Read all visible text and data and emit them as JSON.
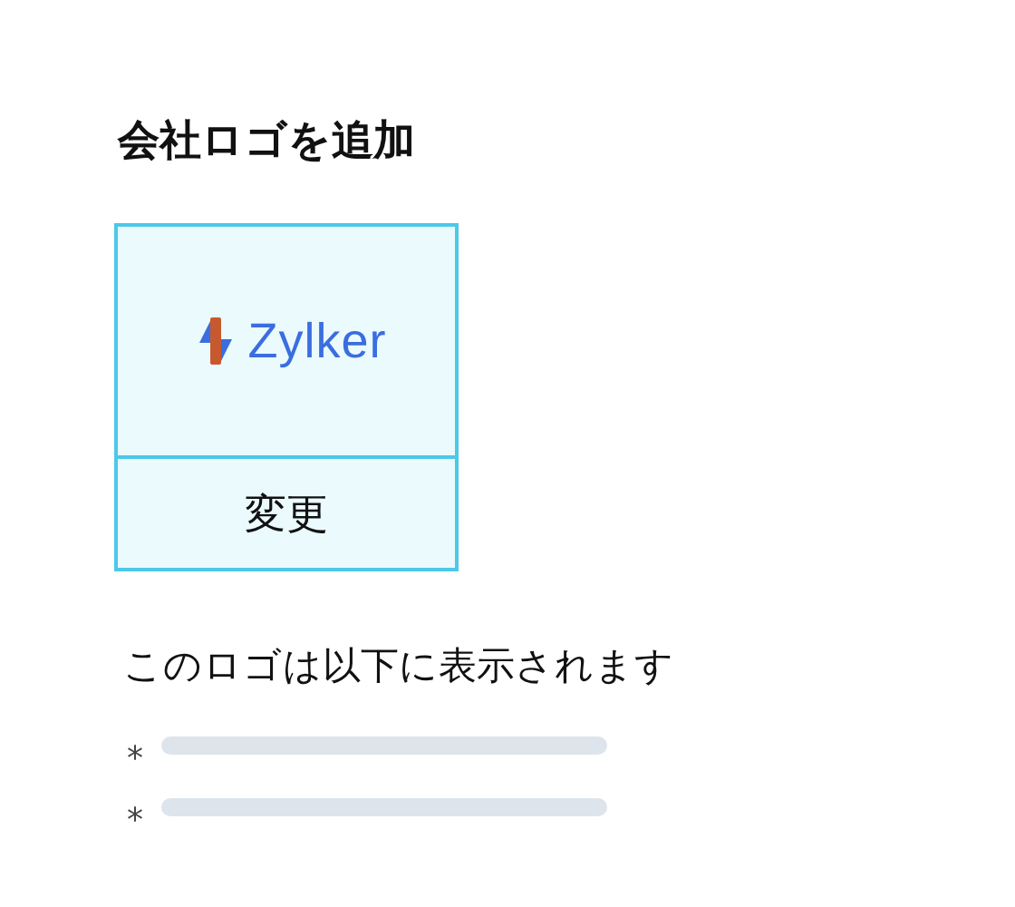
{
  "title": "会社ロゴを追加",
  "logo": {
    "name": "Zylker"
  },
  "change_button": "変更",
  "description": "このロゴは以下に表示されます",
  "placements": [
    {
      "bullet": "*"
    },
    {
      "bullet": "*"
    }
  ]
}
